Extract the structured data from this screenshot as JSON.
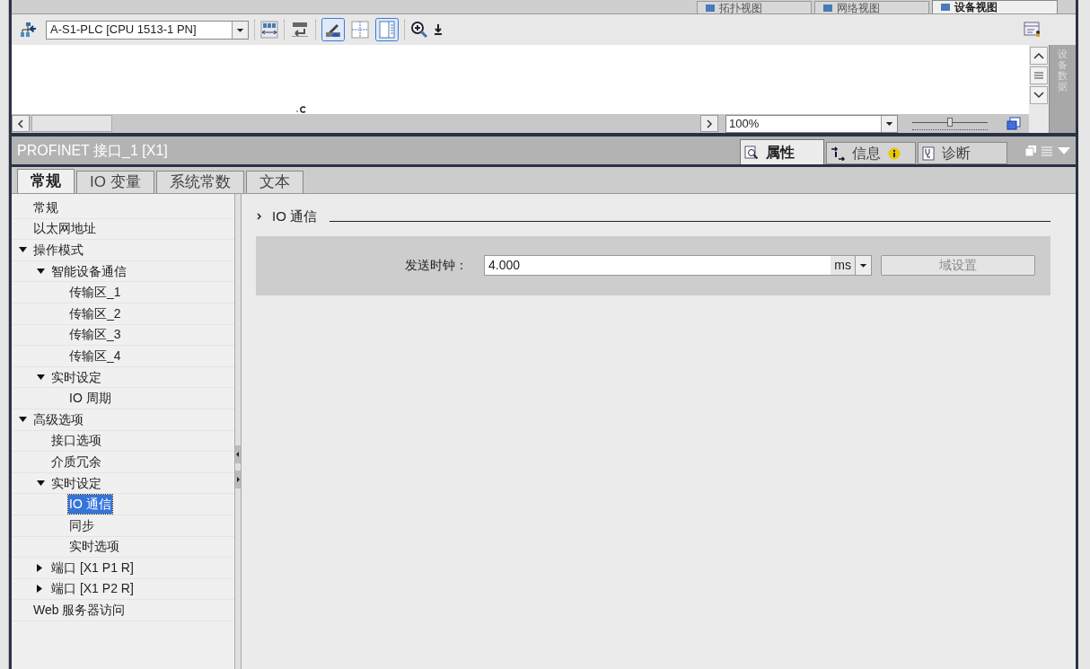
{
  "view_tabs": [
    {
      "label": "拓扑视图",
      "selected": false
    },
    {
      "label": "网络视图",
      "selected": false
    },
    {
      "label": "设备视图",
      "selected": true
    }
  ],
  "toolbar": {
    "device_select": {
      "value": "A-S1-PLC [CPU 1513-1 PN]"
    }
  },
  "canvas": {
    "zoom": {
      "value": "100%"
    },
    "zoom_slider": {
      "level": 0.5
    }
  },
  "side_panel": {
    "title": "设备数据"
  },
  "inspector": {
    "title": "PROFINET 接口_1 [X1]",
    "panel_tabs": [
      {
        "label": "属性",
        "selected": true
      },
      {
        "label": "信息",
        "selected": false
      },
      {
        "label": "诊断",
        "selected": false
      }
    ],
    "tabs": [
      {
        "label": "常规",
        "selected": true
      },
      {
        "label": "IO 变量",
        "selected": false
      },
      {
        "label": "系统常数",
        "selected": false
      },
      {
        "label": "文本",
        "selected": false
      }
    ],
    "tree": [
      {
        "label": "常规",
        "selected": false
      },
      {
        "label": "以太网地址",
        "selected": false
      },
      {
        "label": "操作模式",
        "selected": false,
        "expanded": true,
        "children": [
          {
            "label": "智能设备通信",
            "selected": false,
            "expanded": true,
            "children": [
              {
                "label": "传输区_1",
                "selected": false
              },
              {
                "label": "传输区_2",
                "selected": false
              },
              {
                "label": "传输区_3",
                "selected": false
              },
              {
                "label": "传输区_4",
                "selected": false
              }
            ]
          },
          {
            "label": "实时设定",
            "selected": false,
            "expanded": true,
            "children": [
              {
                "label": "IO 周期",
                "selected": false
              }
            ]
          }
        ]
      },
      {
        "label": "高级选项",
        "selected": false,
        "expanded": true,
        "children": [
          {
            "label": "接口选项",
            "selected": false
          },
          {
            "label": "介质冗余",
            "selected": false
          },
          {
            "label": "实时设定",
            "selected": false,
            "expanded": true,
            "children": [
              {
                "label": "IO 通信",
                "selected": true
              },
              {
                "label": "同步",
                "selected": false
              },
              {
                "label": "实时选项",
                "selected": false
              }
            ]
          },
          {
            "label": "端口 [X1 P1 R]",
            "selected": false,
            "expanded": false
          },
          {
            "label": "端口 [X1 P2 R]",
            "selected": false,
            "expanded": false
          }
        ]
      },
      {
        "label": "Web 服务器访问",
        "selected": false
      }
    ],
    "section": {
      "title": "IO 通信",
      "field": {
        "label": "发送时钟：",
        "value": "4.000",
        "unit": "ms"
      },
      "button": {
        "label": "域设置",
        "disabled": true
      }
    }
  }
}
